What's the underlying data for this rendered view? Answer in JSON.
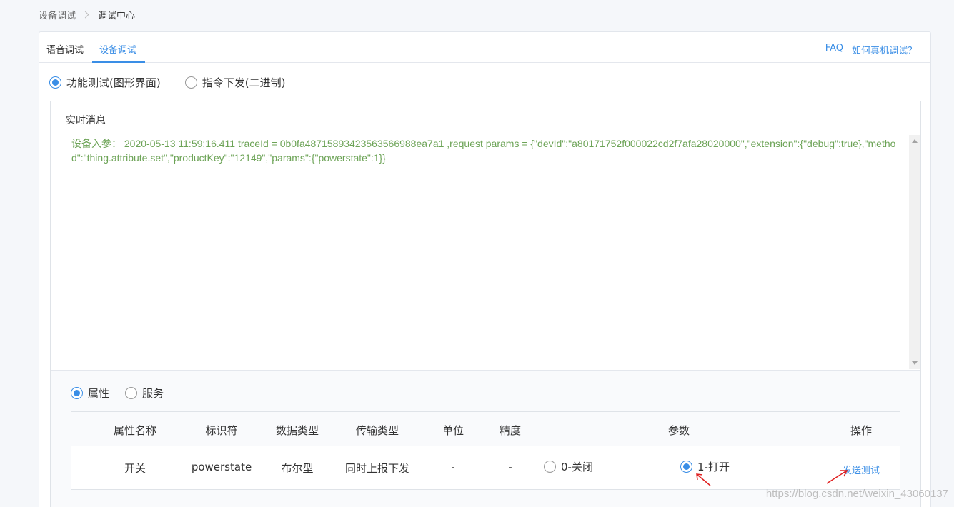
{
  "breadcrumb": {
    "parent": "设备调试",
    "current": "调试中心"
  },
  "tabs": [
    {
      "label": "语音调试",
      "active": false
    },
    {
      "label": "设备调试",
      "active": true
    }
  ],
  "top_links": {
    "faq": "FAQ",
    "howto": "如何真机调试？"
  },
  "mode": {
    "options": [
      {
        "label": "功能测试(图形界面)",
        "checked": true
      },
      {
        "label": "指令下发(二进制)",
        "checked": false
      }
    ]
  },
  "message": {
    "title": "实时消息",
    "log": "设备入参： 2020-05-13 11:59:16.411 traceId = 0b0fa48715893423563566988ea7a1 ,request params = {\"devId\":\"a80171752f000022cd2f7afa28020000\",\"extension\":{\"debug\":true},\"method\":\"thing.attribute.set\",\"productKey\":\"12149\",\"params\":{\"powerstate\":1}}"
  },
  "category": {
    "options": [
      {
        "label": "属性",
        "checked": true
      },
      {
        "label": "服务",
        "checked": false
      }
    ]
  },
  "table": {
    "headers": [
      "属性名称",
      "标识符",
      "数据类型",
      "传输类型",
      "单位",
      "精度",
      "参数",
      "操作"
    ],
    "row": {
      "name": "开关",
      "identifier": "powerstate",
      "data_type": "布尔型",
      "transfer_type": "同时上报下发",
      "unit": "-",
      "precision": "-",
      "param_options": [
        {
          "label": "0-关闭",
          "checked": false
        },
        {
          "label": "1-打开",
          "checked": true
        }
      ],
      "action": "发送测试"
    }
  },
  "watermark": "https://blog.csdn.net/weixin_43060137",
  "colors": {
    "accent": "#3a8ee6",
    "log_text": "#6ca356",
    "annotation_arrow": "#e02020"
  }
}
